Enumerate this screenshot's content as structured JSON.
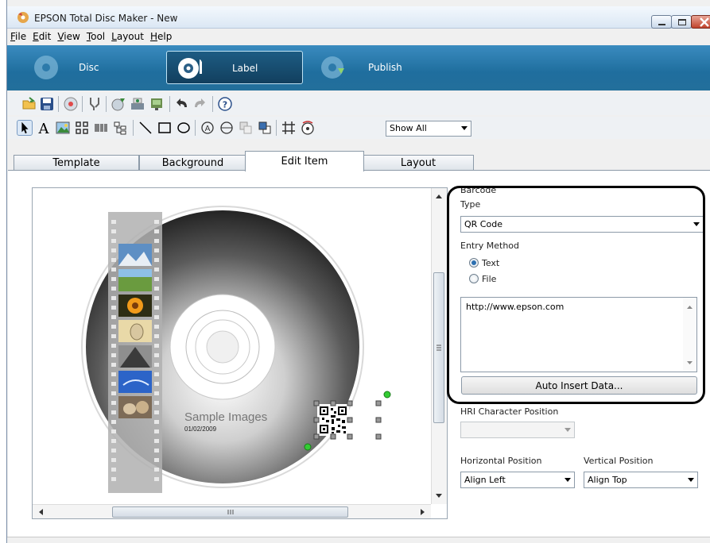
{
  "window": {
    "title": "EPSON Total Disc Maker - New",
    "controls": {
      "minimize": "minimize",
      "maximize": "maximize",
      "close": "close"
    }
  },
  "menu": {
    "items": [
      {
        "label": "File",
        "mnemonic": "F"
      },
      {
        "label": "Edit",
        "mnemonic": "E"
      },
      {
        "label": "View",
        "mnemonic": "V"
      },
      {
        "label": "Tool",
        "mnemonic": "T"
      },
      {
        "label": "Layout",
        "mnemonic": "L"
      },
      {
        "label": "Help",
        "mnemonic": "H"
      }
    ]
  },
  "modes": [
    {
      "label": "Disc",
      "active": false
    },
    {
      "label": "Label",
      "active": true
    },
    {
      "label": "Publish",
      "active": false
    }
  ],
  "toolbar": {
    "show_all_label": "Show All"
  },
  "tabs": [
    {
      "label": "Template",
      "active": false
    },
    {
      "label": "Background",
      "active": false
    },
    {
      "label": "Edit Item",
      "active": true
    },
    {
      "label": "Layout",
      "active": false
    }
  ],
  "canvas": {
    "title_text": "Sample Images",
    "date_text": "01/02/2009"
  },
  "properties": {
    "section_title": "Barcode",
    "type_label": "Type",
    "type_value": "QR Code",
    "entry_method_label": "Entry Method",
    "radio_text": "Text",
    "radio_file": "File",
    "entry_method_selected": "Text",
    "data_text": "http://www.epson.com",
    "auto_insert_label": "Auto Insert Data...",
    "hri_label": "HRI Character Position",
    "hri_value": "",
    "horizontal_label": "Horizontal Position",
    "horizontal_value": "Align Left",
    "vertical_label": "Vertical Position",
    "vertical_value": "Align Top"
  },
  "colors": {
    "mode_bar": "#1f6e9e",
    "selection_handle": "#33cc33",
    "radio_accent": "#2c6fb0"
  }
}
